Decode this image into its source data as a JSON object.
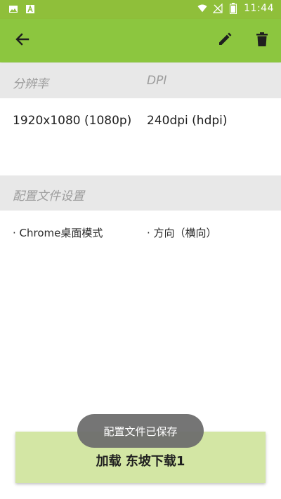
{
  "status_bar": {
    "time": "11:44",
    "left_icons": [
      "image-icon",
      "a-badge-icon"
    ],
    "right_icons": [
      "wifi-icon",
      "no-signal-icon",
      "battery-icon"
    ]
  },
  "app_bar": {
    "color": "#8cc63f",
    "actions": [
      "back-arrow-icon",
      "edit-pencil-icon",
      "delete-trash-icon"
    ]
  },
  "resolution_section": {
    "col1_header": "分辨率",
    "col2_header": "DPI",
    "resolution_value": "1920x1080 (1080p)",
    "dpi_value": "240dpi (hdpi)"
  },
  "profile_section": {
    "header": "配置文件设置",
    "settings": [
      "· Chrome桌面模式",
      "· 方向（横向）"
    ]
  },
  "action_button": {
    "label": "加载 东坡下载1",
    "color": "#d3e6a4"
  },
  "toast": {
    "message": "配置文件已保存"
  }
}
